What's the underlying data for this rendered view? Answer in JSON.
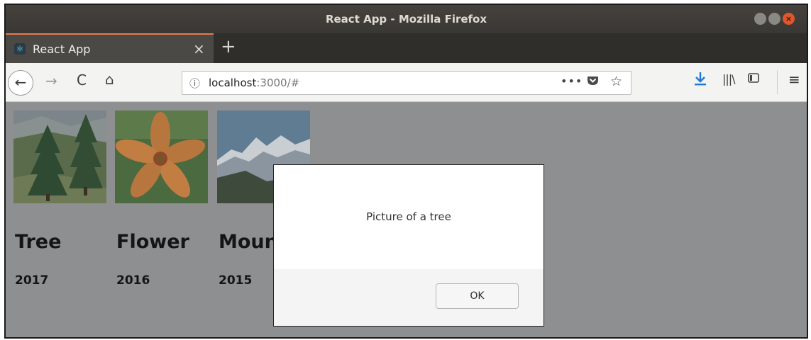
{
  "window": {
    "title": "React App - Mozilla Firefox",
    "controls": [
      "minimize-icon",
      "maximize-icon",
      "close-icon"
    ]
  },
  "tabs": [
    {
      "label": "React App",
      "favicon": "react-logo-icon",
      "close_glyph": "×"
    }
  ],
  "new_tab_glyph": "+",
  "navbar": {
    "back_glyph": "←",
    "forward_glyph": "→",
    "reload_glyph": "C",
    "home_glyph": "⌂",
    "url_host": "localhost",
    "url_rest": ":3000/#",
    "info_glyph": "ⓘ",
    "page_actions_glyph": "•••",
    "pocket_glyph": "◈",
    "bookmark_glyph": "☆",
    "downloads_glyph": "⤓",
    "library_glyph": "|||\\",
    "sidebar_glyph": "◫",
    "menu_glyph": "≡"
  },
  "gallery": [
    {
      "title": "Tree",
      "year": "2017"
    },
    {
      "title": "Flower",
      "year": "2016"
    },
    {
      "title": "Mountain",
      "year": "2015"
    }
  ],
  "dialog": {
    "message": "Picture of a tree",
    "ok_label": "OK"
  }
}
